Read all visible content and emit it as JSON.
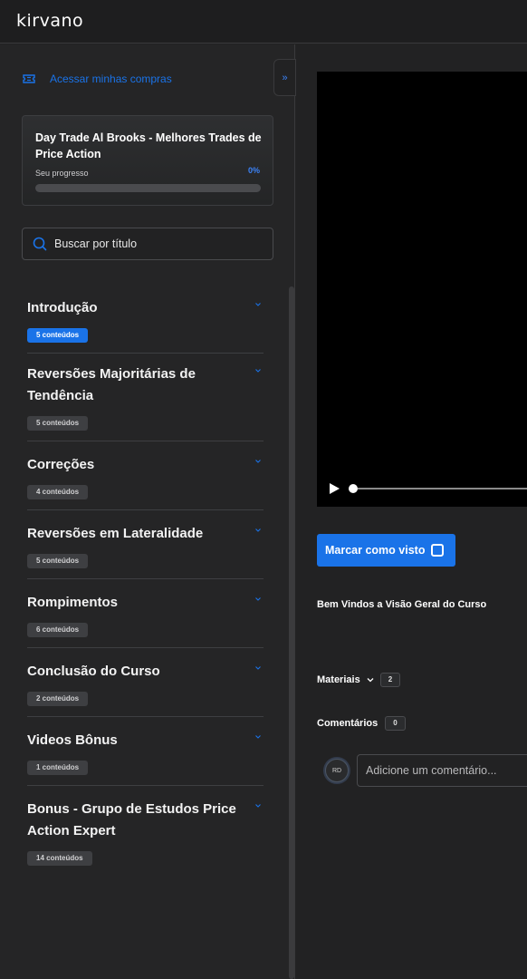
{
  "app": {
    "logo_text": "kirvano"
  },
  "sidebar": {
    "purchases_link": "Acessar minhas compras",
    "course": {
      "title": "Day Trade Al Brooks - Melhores Trades de Price Action",
      "progress_label": "Seu progresso",
      "progress_text": "0%",
      "progress_value": 0
    },
    "search": {
      "placeholder": "Buscar por título"
    },
    "modules": [
      {
        "title": "Introdução",
        "count": "5 conteúdos",
        "active": true
      },
      {
        "title": "Reversões Majoritárias de Tendência",
        "count": "5 conteúdos",
        "active": false
      },
      {
        "title": "Correções",
        "count": "4 conteúdos",
        "active": false
      },
      {
        "title": "Reversões em Lateralidade",
        "count": "5 conteúdos",
        "active": false
      },
      {
        "title": "Rompimentos",
        "count": "6 conteúdos",
        "active": false
      },
      {
        "title": "Conclusão do Curso",
        "count": "2 conteúdos",
        "active": false
      },
      {
        "title": "Videos Bônus",
        "count": "1 conteúdos",
        "active": false
      },
      {
        "title": "Bonus - Grupo de Estudos Price Action Expert",
        "count": "14 conteúdos",
        "active": false
      }
    ]
  },
  "main": {
    "mark_seen_label": "Marcar como visto",
    "lesson_title": "Bem Vindos a Visão Geral do Curso",
    "materials_label": "Materiais",
    "materials_count": "2",
    "comments_label": "Comentários",
    "comments_count": "0",
    "avatar_initials": "RD",
    "comment_placeholder": "Adicione um comentário..."
  },
  "colors": {
    "accent": "#1a73e8",
    "background": "#222223",
    "sidebar": "#252526",
    "badge": "#3e3f42"
  }
}
